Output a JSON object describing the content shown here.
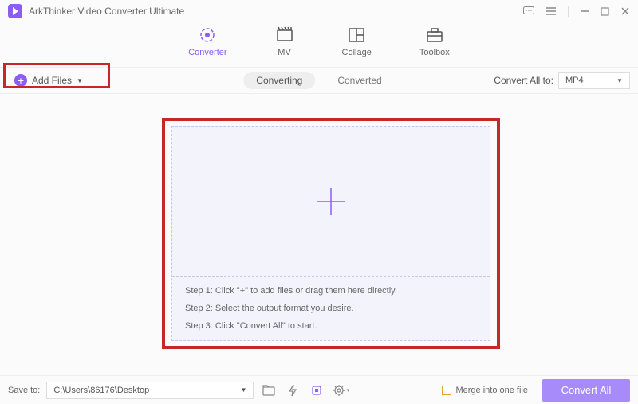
{
  "titlebar": {
    "title": "ArkThinker Video Converter Ultimate"
  },
  "modes": {
    "converter": "Converter",
    "mv": "MV",
    "collage": "Collage",
    "toolbox": "Toolbox"
  },
  "toolbar": {
    "add_files": "Add Files",
    "tab_converting": "Converting",
    "tab_converted": "Converted",
    "convert_all_to": "Convert All to:",
    "format_selected": "MP4"
  },
  "dropzone": {
    "step1": "Step 1: Click \"+\" to add files or drag them here directly.",
    "step2": "Step 2: Select the output format you desire.",
    "step3": "Step 3: Click \"Convert All\" to start."
  },
  "footer": {
    "save_to": "Save to:",
    "save_path": "C:\\Users\\86176\\Desktop",
    "merge": "Merge into one file",
    "convert_all": "Convert All"
  }
}
